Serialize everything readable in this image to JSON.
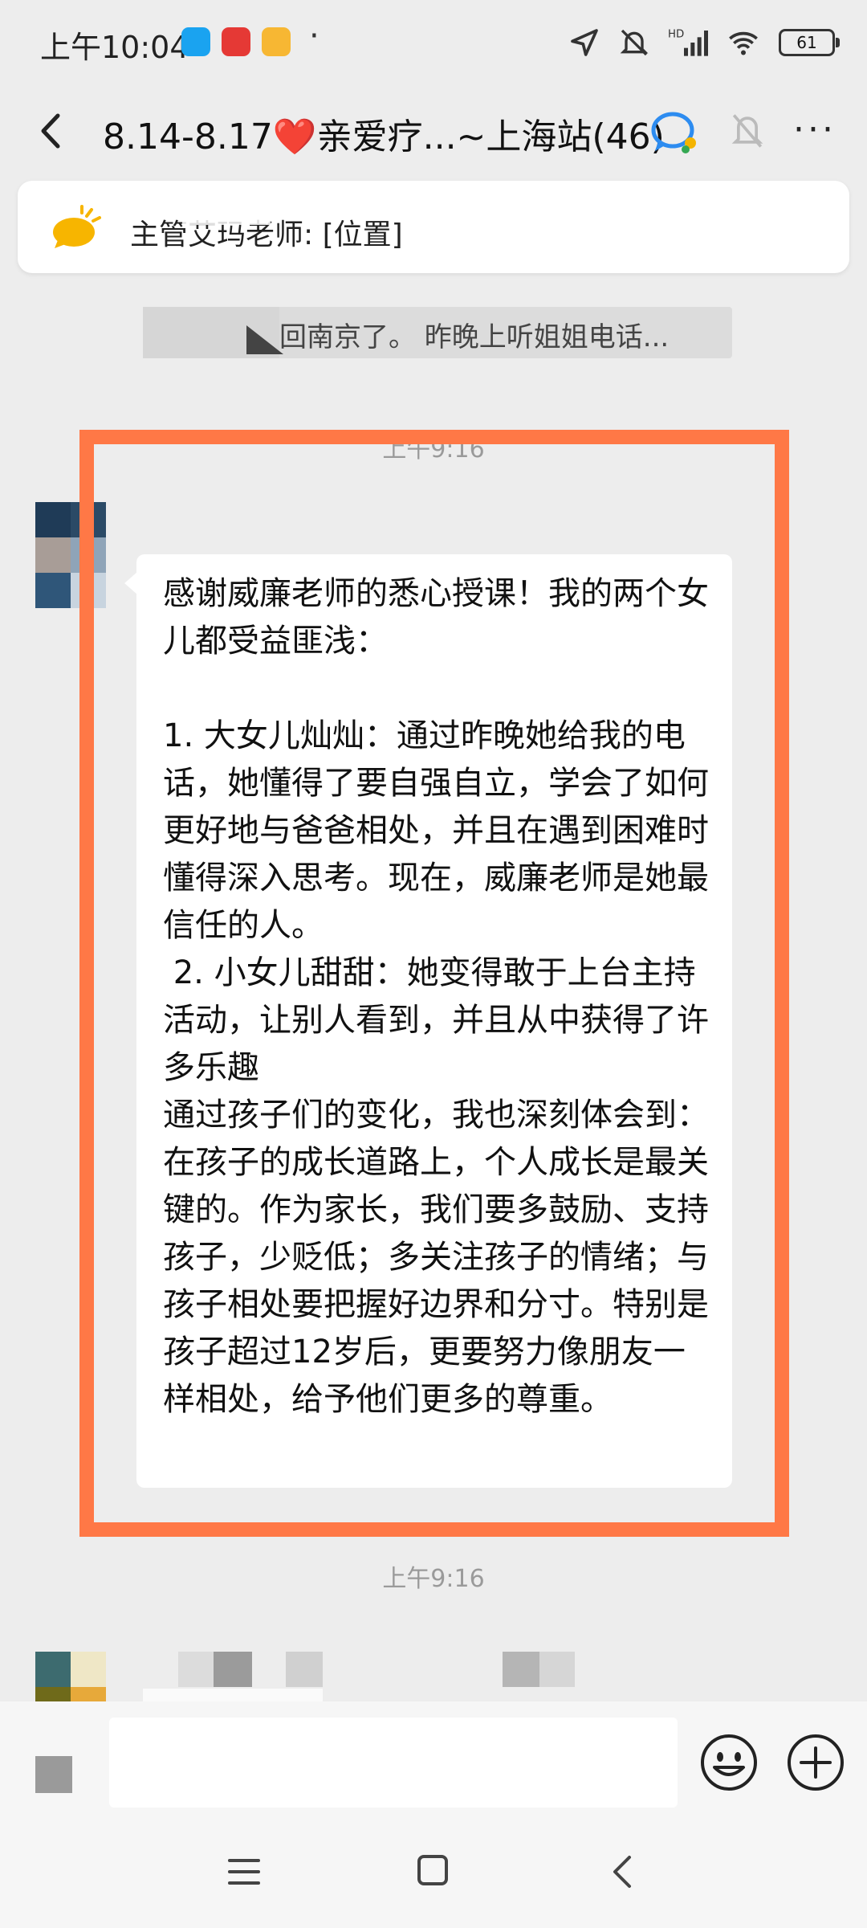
{
  "status_bar": {
    "time": "上午10:04",
    "battery": "61"
  },
  "header": {
    "title": "8.14-8.17❤️亲爱疗...~上海站(46)"
  },
  "pinned": {
    "text": "主管艾玛老师: [位置]"
  },
  "quote": {
    "text": "回南京了。 昨晚上听姐姐电话..."
  },
  "chat": {
    "timestamp_1": "上午9:16",
    "timestamp_2": "上午9:16",
    "message": "感谢威廉老师的悉心授课！我的两个女儿都受益匪浅：\n\n1. 大女儿灿灿：通过昨晚她给我的电话，她懂得了要自强自立，学会了如何更好地与爸爸相处，并且在遇到困难时懂得深入思考。现在，威廉老师是她最信任的人。\n 2. 小女儿甜甜：她变得敢于上台主持活动，让别人看到，并且从中获得了许多乐趣\n通过孩子们的变化，我也深刻体会到：在孩子的成长道路上，个人成长是最关键的。作为家长，我们要多鼓励、支持孩子，少贬低；多关注孩子的情绪；与孩子相处要把握好边界和分寸。特别是孩子超过12岁后，更要努力像朋友一样相处，给予他们更多的尊重。"
  },
  "colors": {
    "highlight": "#ff7846",
    "background": "#ededed"
  },
  "icons": {
    "back": "chevron-left-icon",
    "group": "chat-bubble-icon",
    "mute": "bell-off-icon",
    "more": "more-dots-icon",
    "pinned": "megaphone-icon",
    "emoji": "emoji-icon",
    "plus": "plus-icon"
  }
}
